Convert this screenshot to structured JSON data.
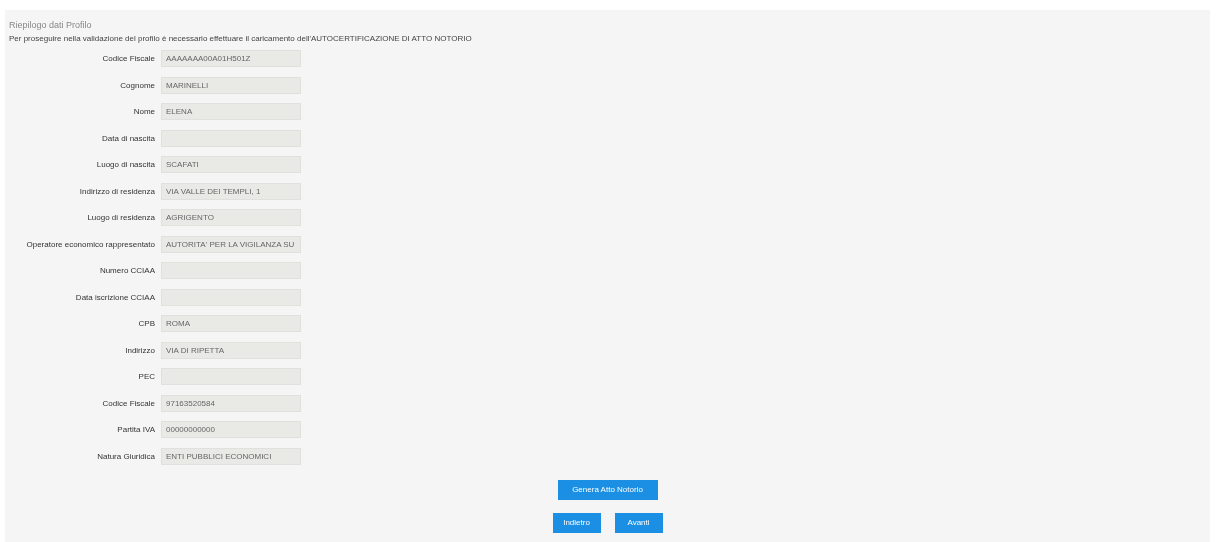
{
  "title": "Riepilogo dati Profilo",
  "intro": "Per proseguire nella validazione del profilo è necessario effettuare il caricamento dell'AUTOCERTIFICAZIONE DI ATTO NOTORIO",
  "fields": [
    {
      "label": "Codice Fiscale",
      "value": "AAAAAAA00A01H501Z"
    },
    {
      "label": "Cognome",
      "value": "MARINELLI"
    },
    {
      "label": "Nome",
      "value": "ELENA"
    },
    {
      "label": "Data di nascita"
    },
    {
      "label": "Luogo di nascita",
      "value": "SCAFATI"
    },
    {
      "label": "Indirizzo di residenza",
      "value": "VIA VALLE DEI TEMPLI, 1"
    },
    {
      "label": "Luogo di residenza",
      "value": "AGRIGENTO"
    },
    {
      "label": "Operatore economico rappresentato",
      "value": "AUTORITA' PER LA VIGILANZA SU"
    },
    {
      "label": "Numero CCIAA"
    },
    {
      "label": "Data iscrizione CCIAA"
    },
    {
      "label": "CPB",
      "value": "ROMA"
    },
    {
      "label": "Indirizzo",
      "value": "VIA DI RIPETTA"
    },
    {
      "label": "PEC"
    },
    {
      "label": "Codice Fiscale",
      "value": "97163520584"
    },
    {
      "label": "Partita IVA",
      "value": "00000000000"
    },
    {
      "label": "Natura Giuridica",
      "value": "ENTI PUBBLICI ECONOMICI"
    }
  ],
  "primary_button": "Genera Atto Notorio",
  "nav_buttons": [
    "Indietro",
    "Avanti"
  ]
}
